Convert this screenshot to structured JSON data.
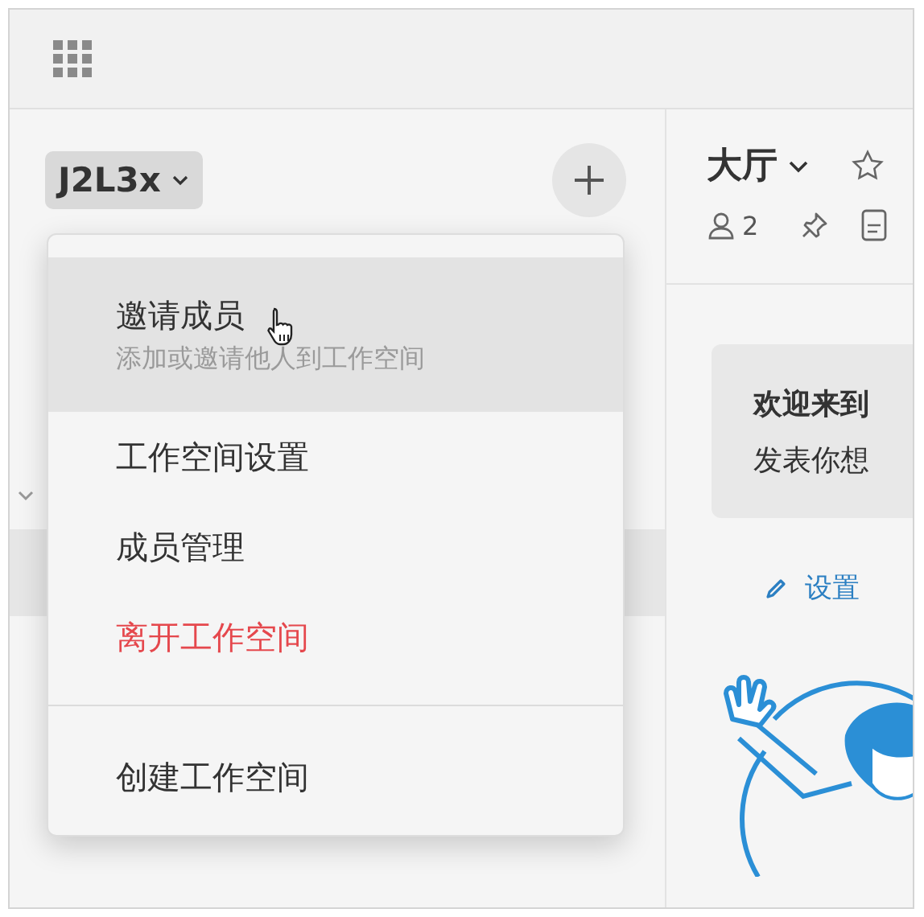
{
  "workspace": {
    "name": "J2L3x"
  },
  "menu": {
    "items": [
      {
        "kind": "action",
        "label": "邀请成员",
        "description": "添加或邀请他人到工作空间",
        "selected": true
      },
      {
        "kind": "action",
        "label": "工作空间设置",
        "selected": false
      },
      {
        "kind": "action",
        "label": "成员管理",
        "selected": false
      },
      {
        "kind": "danger",
        "label": "离开工作空间",
        "selected": false
      },
      {
        "kind": "divider"
      },
      {
        "kind": "action",
        "label": "创建工作空间",
        "selected": false
      }
    ]
  },
  "channel": {
    "name": "大厅",
    "member_count": "2",
    "welcome": {
      "title": "欢迎来到",
      "body": "发表你想"
    },
    "set_topic_link": "设置"
  }
}
